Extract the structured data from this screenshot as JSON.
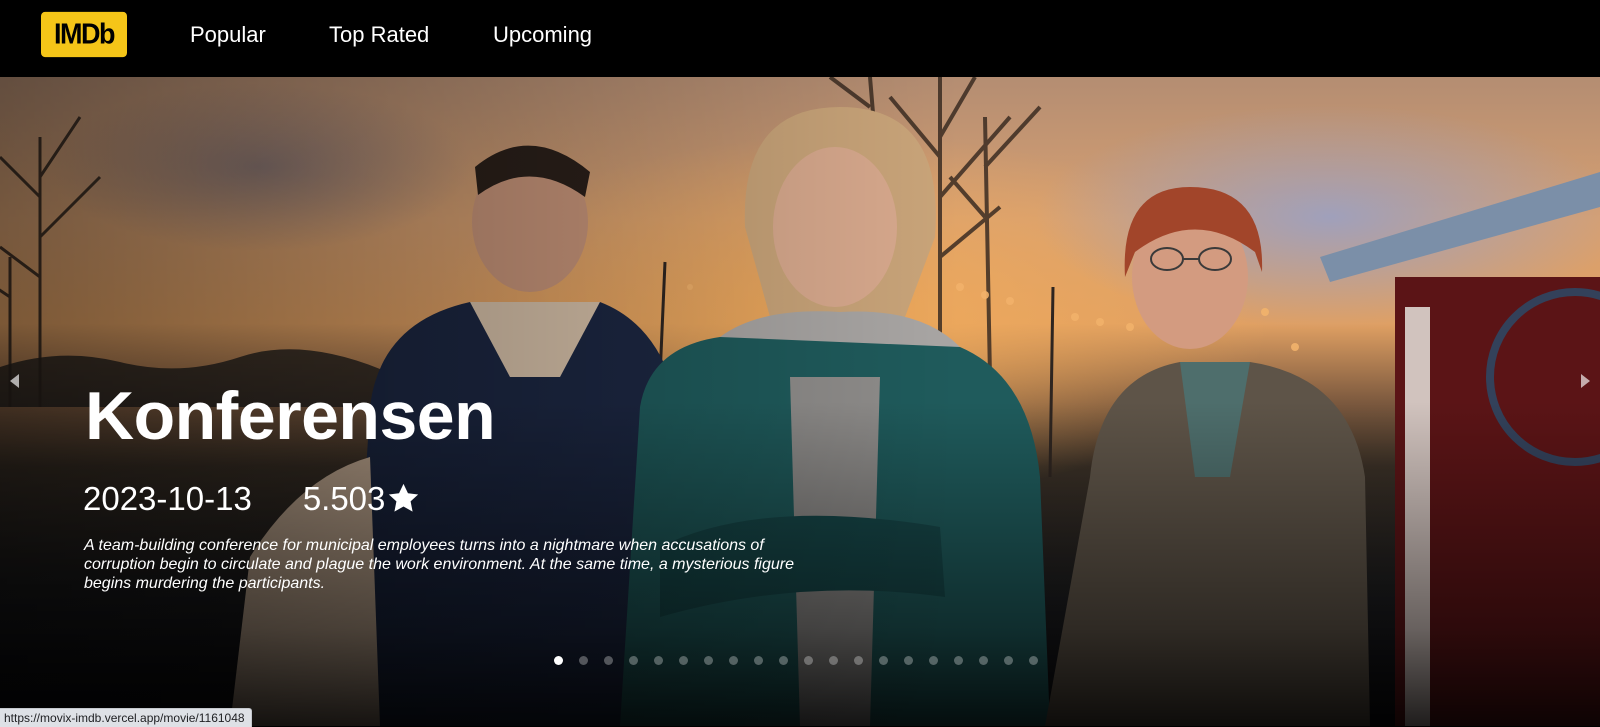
{
  "header": {
    "logo_text": "IMDb",
    "nav": {
      "popular": "Popular",
      "top_rated": "Top Rated",
      "upcoming": "Upcoming"
    }
  },
  "hero": {
    "title": "Konferensen",
    "release_date": "2023-10-13",
    "rating": "5.503",
    "overview": "A team-building conference for municipal employees turns into a nightmare when accusations of corruption begin to circulate and plague the work environment. At the same time, a mysterious figure begins murdering the participants.",
    "slide_count": 20,
    "active_slide": 1
  },
  "colors": {
    "brand_yellow": "#f5c518",
    "header_bg": "#000000",
    "text": "#ffffff"
  },
  "status_bar": {
    "url": "https://movix-imdb.vercel.app/movie/1161048"
  }
}
